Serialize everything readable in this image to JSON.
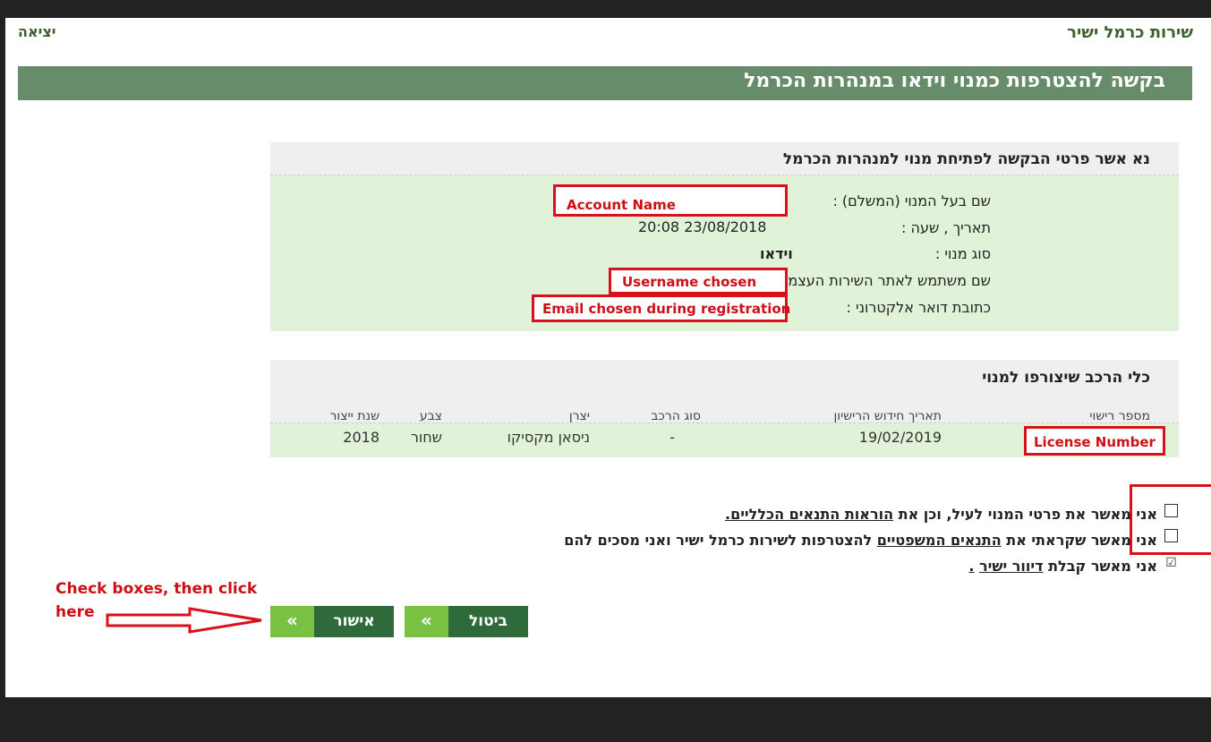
{
  "header": {
    "site_title": "שירות כרמל ישיר",
    "exit_label": "יציאה",
    "page_title": "בקשה להצטרפות כמנוי וידאו במנהרות הכרמל"
  },
  "confirm_section": {
    "title": "נא אשר פרטי הבקשה לפתיחת מנוי למנהרות הכרמל",
    "fields": [
      {
        "label": "שם בעל המנוי (המשלם) :",
        "value": "Account Name"
      },
      {
        "label": "תאריך , שעה :",
        "value": "20:08 23/08/2018"
      },
      {
        "label": "סוג מנוי :",
        "value": "וידאו"
      },
      {
        "label": "שם משתמש לאתר השירות העצמי באינטרנט :",
        "value": "Username chosen"
      },
      {
        "label": "כתובת דואר אלקטרוני :",
        "value": "Email chosen during registration"
      }
    ]
  },
  "vehicles_section": {
    "title": "כלי הרכב שיצורפו למנוי",
    "columns": [
      "מספר רישוי",
      "תאריך חידוש הרישיון",
      "סוג הרכב",
      "יצרן",
      "צבע",
      "שנת ייצור"
    ],
    "rows": [
      {
        "license": "License Number",
        "renewal": "19/02/2019",
        "type": "-",
        "maker": "ניסאן מקסיקו",
        "color": "שחור",
        "year": "2018"
      }
    ]
  },
  "agreements": {
    "item1_text": "אני מאשר את פרטי המנוי לעיל, וכן את",
    "item1_link": "הוראות התנאים הכלליים.",
    "item1_checked": false,
    "item2_text": "אני מאשר שקראתי את",
    "item2_link": "התנאים המשפטיים",
    "item2_tail": "להצטרפות לשירות כרמל ישיר ואני מסכים להם",
    "item2_checked": false,
    "item3_text": "אני מאשר קבלת",
    "item3_link": "דיוור ישיר",
    "item3_tail": ".",
    "item3_checked": true,
    "check_mark": "☑"
  },
  "buttons": {
    "confirm_label": "אישור",
    "cancel_label": "ביטול",
    "arrow_glyph": "«"
  },
  "annotation": {
    "line1": "Check boxes, then click",
    "line2": "here"
  },
  "colors": {
    "banner": "#668c6a",
    "panel_bg": "#e0f2d8",
    "button_dark": "#2e6a3a",
    "button_light": "#7ac143",
    "annotation_red": "#d8111c"
  }
}
